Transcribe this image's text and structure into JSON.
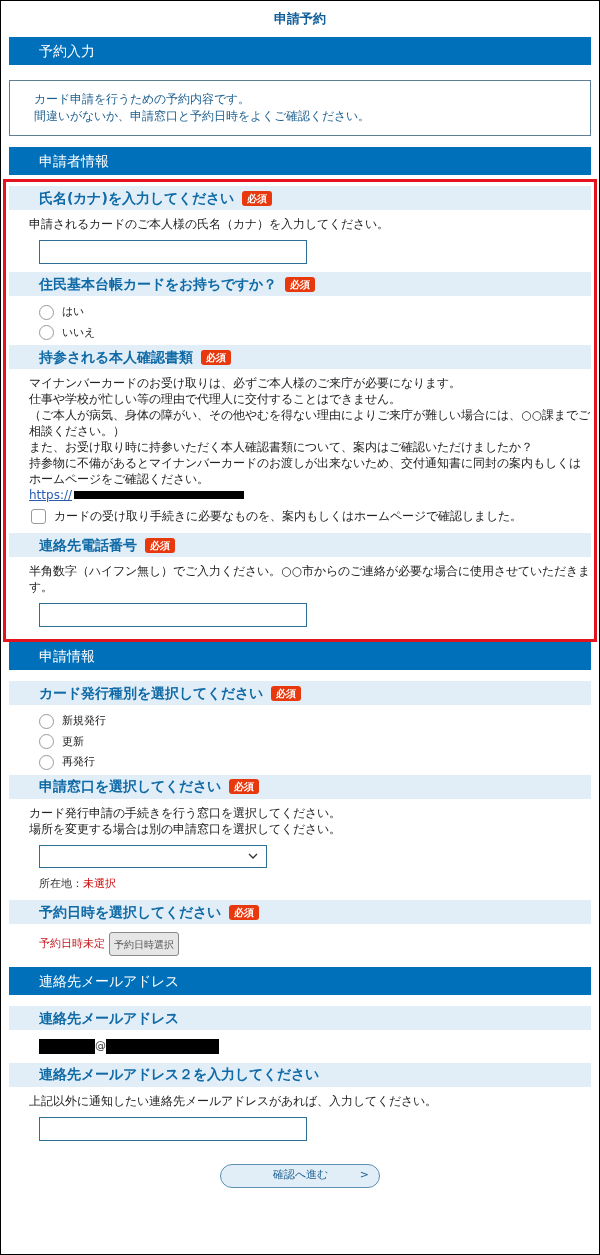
{
  "page_title": "申請予約",
  "sections": [
    {
      "title": "予約入力",
      "highlighted": false,
      "notice": [
        "カード申請を行うための予約内容です。",
        "間違いがないか、申請窓口と予約日時をよくご確認ください。"
      ]
    },
    {
      "title": "申請者情報",
      "highlighted": true,
      "fields": [
        {
          "label": "氏名(カナ)を入力してください",
          "badge": "必須",
          "items": [
            {
              "kind": "text",
              "lines": [
                "申請されるカードのご本人様の氏名（カナ）を入力してください。"
              ]
            },
            {
              "kind": "input"
            }
          ]
        },
        {
          "label": "住民基本台帳カードをお持ちですか？",
          "badge": "必須",
          "items": [
            {
              "kind": "radio",
              "options": [
                {
                  "label": "はい",
                  "selected": false
                },
                {
                  "label": "いいえ",
                  "selected": false
                }
              ]
            }
          ]
        },
        {
          "label": "持参される本人確認書類",
          "badge": "必須",
          "items": [
            {
              "kind": "text",
              "lines": [
                "マイナンバーカードのお受け取りは、必ずご本人様のご来庁が必要になります。",
                "仕事や学校が忙しい等の理由で代理人に交付することはできません。",
                "（ご本人が病気、身体の障がい、その他やむを得ない理由によりご来庁が難しい場合には、○○課までご相談ください。）",
                "また、お受け取り時に持参いただく本人確認書類について、案内はご確認いただけましたか？",
                "持参物に不備があるとマイナンバーカードのお渡しが出来ないため、交付通知書に同封の案内もしくはホームページをご確認ください。"
              ]
            },
            {
              "kind": "link",
              "text": "https://"
            },
            {
              "kind": "checkbox",
              "label": "カードの受け取り手続きに必要なものを、案内もしくはホームページで確認しました。",
              "checked": false
            }
          ]
        },
        {
          "label": "連絡先電話番号",
          "badge": "必須",
          "items": [
            {
              "kind": "text",
              "lines": [
                "半角数字（ハイフン無し）でご入力ください。○○市からのご連絡が必要な場合に使用させていただきます。"
              ]
            },
            {
              "kind": "input"
            }
          ]
        }
      ]
    },
    {
      "title": "申請情報",
      "highlighted": false,
      "fields": [
        {
          "label": "カード発行種別を選択してください",
          "badge": "必須",
          "items": [
            {
              "kind": "radio",
              "options": [
                {
                  "label": "新規発行",
                  "selected": false
                },
                {
                  "label": "更新",
                  "selected": false
                },
                {
                  "label": "再発行",
                  "selected": false
                }
              ]
            }
          ]
        },
        {
          "label": "申請窓口を選択してください",
          "badge": "必須",
          "items": [
            {
              "kind": "text",
              "lines": [
                "カード発行申請の手続きを行う窓口を選択してください。",
                "場所を変更する場合は別の申請窓口を選択してください。"
              ]
            },
            {
              "kind": "select"
            },
            {
              "kind": "status",
              "label": "所在地：",
              "value": "未選択"
            }
          ]
        },
        {
          "label": "予約日時を選択してください",
          "badge": "必須",
          "items": [
            {
              "kind": "date",
              "status": "予約日時未定",
              "button": "予約日時選択"
            }
          ]
        }
      ]
    },
    {
      "title": "連絡先メールアドレス",
      "highlighted": false,
      "fields": [
        {
          "label": "連絡先メールアドレス",
          "items": [
            {
              "kind": "email",
              "separator": "@"
            }
          ]
        },
        {
          "label": "連絡先メールアドレス２を入力してください",
          "items": [
            {
              "kind": "text",
              "lines": [
                "上記以外に通知したい連絡先メールアドレスがあれば、入力してください。"
              ]
            },
            {
              "kind": "input"
            }
          ]
        }
      ]
    }
  ],
  "submit": {
    "label": "確認へ進む",
    "arrow": ">"
  }
}
